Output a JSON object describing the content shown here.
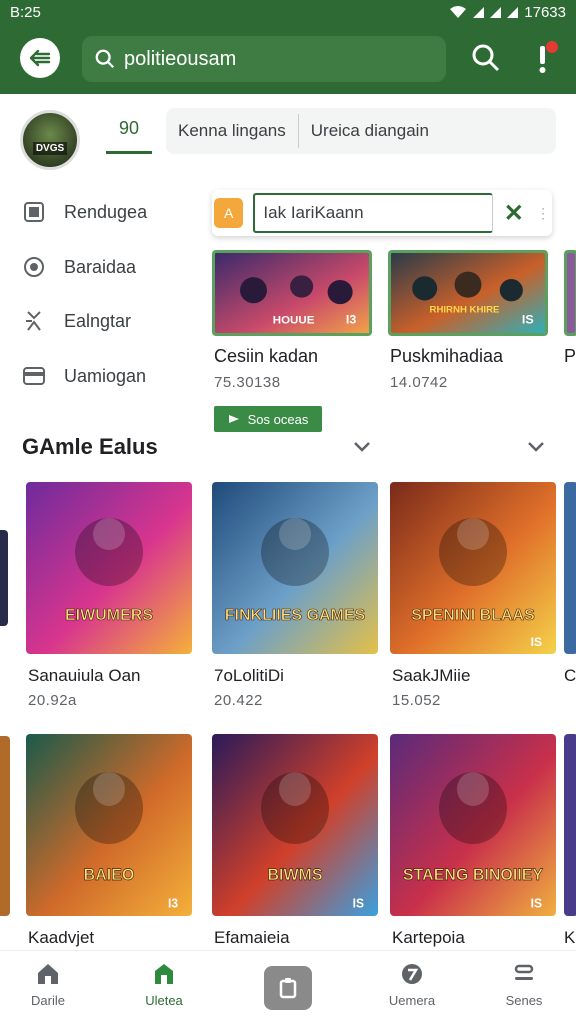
{
  "status_bar": {
    "time_left": "B:25",
    "time_right": "17633"
  },
  "top_bar": {
    "search_text": "politieousam"
  },
  "header": {
    "avatar_label": "DVGS",
    "active_tab_label": "90",
    "chips": [
      "Kenna lingans",
      "Ureica diangain"
    ]
  },
  "side_menu": {
    "items": [
      {
        "label": "Rendugea",
        "icon": "square-icon"
      },
      {
        "label": "Baraidaa",
        "icon": "target-icon"
      },
      {
        "label": "Ealngtar",
        "icon": "puzzle-icon"
      },
      {
        "label": "Uamiogan",
        "icon": "card-icon"
      }
    ]
  },
  "float_input": {
    "value": "Iak IariKaann",
    "badge": "A"
  },
  "featured": {
    "items": [
      {
        "title": "Cesiin kadan",
        "sub": "75.30138",
        "art_label": "HOUUE",
        "tag": "I3",
        "colors": [
          "#3b2a6b",
          "#c94a6a",
          "#f1a24a"
        ]
      },
      {
        "title": "Puskmihadiaa",
        "sub": "14.0742",
        "art_label": "RHIRNH KHIRE",
        "tag": "IS",
        "colors": [
          "#2a3b4a",
          "#c9602a",
          "#2fb0b9"
        ]
      }
    ],
    "partial_label": "P",
    "install_label": "Sos oceas"
  },
  "section": {
    "title": "GAmle Ealus"
  },
  "games": [
    {
      "title": "Sanauiula Oan",
      "sub": "20.92a",
      "art_label": "EIWUMERS",
      "tag": "",
      "colors": [
        "#6d2b9c",
        "#d8358e",
        "#f4b13a"
      ]
    },
    {
      "title": "7oLolitiDi",
      "sub": "20.422",
      "art_label": "FINKLIIES GAMES",
      "tag": "",
      "colors": [
        "#1f4a7a",
        "#6da0c8",
        "#e4c048"
      ]
    },
    {
      "title": "SaakJMiie",
      "sub": "15.052",
      "art_label": "SPENINI BLAAS",
      "tag": "IS",
      "colors": [
        "#7a2a1a",
        "#e0702a",
        "#f5d24a"
      ]
    },
    {
      "title": "Kaadvjet",
      "sub": "",
      "art_label": "BAIEO",
      "tag": "I3",
      "colors": [
        "#1a5a4a",
        "#d06a2a",
        "#f4b03a"
      ]
    },
    {
      "title": "Efamaieia",
      "sub": "",
      "art_label": "BIWMS",
      "tag": "IS",
      "colors": [
        "#2a1a5a",
        "#d0402a",
        "#3aa0e0"
      ]
    },
    {
      "title": "Kartepoia",
      "sub": "",
      "art_label": "STAENG BINOIIEY",
      "tag": "IS",
      "colors": [
        "#5a2a7a",
        "#c9304a",
        "#f0b040"
      ]
    }
  ],
  "partial_labels": {
    "row1": "C",
    "row2": "K"
  },
  "bottom_nav": {
    "items": [
      {
        "label": "Darile",
        "icon": "home-icon"
      },
      {
        "label": "Uletea",
        "icon": "store-icon",
        "active": true
      },
      {
        "label": "Uemera",
        "icon": "gauge-icon"
      },
      {
        "label": "Senes",
        "icon": "menu-icon"
      }
    ],
    "center_icon": "clipboard-icon"
  },
  "colors": {
    "primary": "#2e6b34",
    "accent": "#3a8b45",
    "badge": "#f4a73a"
  }
}
